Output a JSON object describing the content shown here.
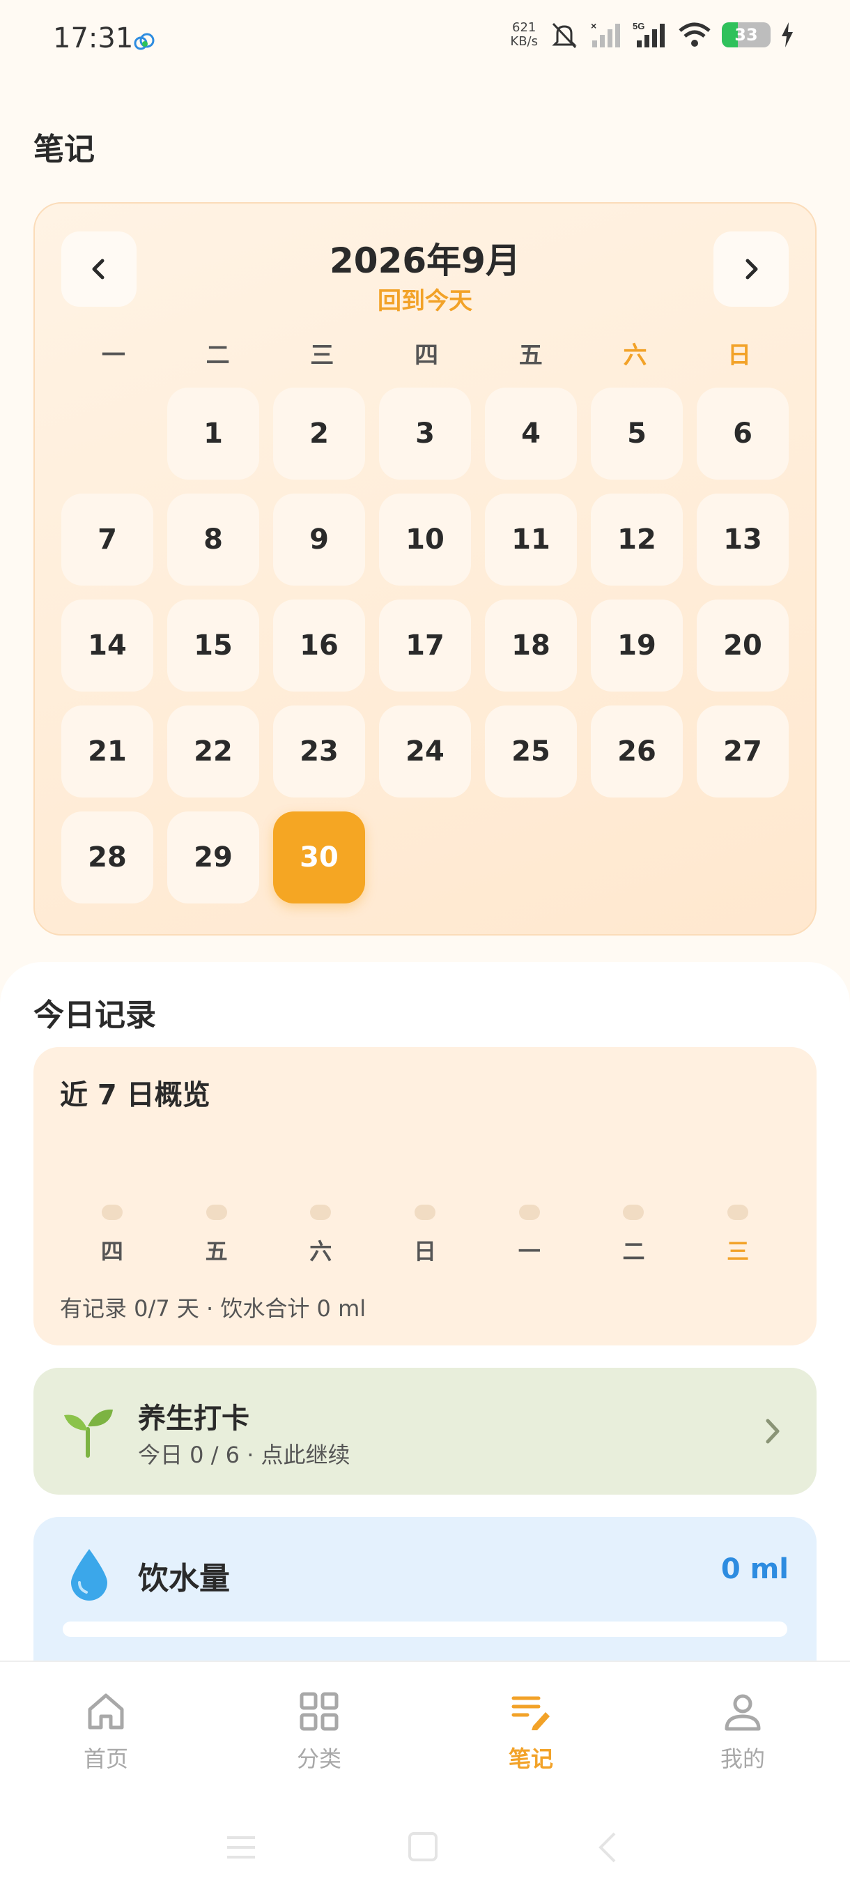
{
  "status_bar": {
    "time": "17:31",
    "net_speed_value": "621",
    "net_speed_unit": "KB/s",
    "network": "5G",
    "battery": "33",
    "battery_level": 0.33
  },
  "page": {
    "title": "笔记"
  },
  "calendar": {
    "month_title": "2026年9月",
    "today_link": "回到今天",
    "weekdays": [
      "一",
      "二",
      "三",
      "四",
      "五",
      "六",
      "日"
    ],
    "days": [
      "",
      "1",
      "2",
      "3",
      "4",
      "5",
      "6",
      "7",
      "8",
      "9",
      "10",
      "11",
      "12",
      "13",
      "14",
      "15",
      "16",
      "17",
      "18",
      "19",
      "20",
      "21",
      "22",
      "23",
      "24",
      "25",
      "26",
      "27",
      "28",
      "29",
      "30"
    ],
    "selected_day": "30",
    "accent_color": "#f5a623"
  },
  "records": {
    "section_title": "今日记录",
    "overview": {
      "title": "近 7 日概览",
      "days": [
        "四",
        "五",
        "六",
        "日",
        "一",
        "二",
        "三"
      ],
      "summary": "有记录 0/7 天 · 饮水合计 0 ml"
    },
    "checkin": {
      "title": "养生打卡",
      "subtitle": "今日 0 / 6 · 点此继续",
      "color": "#e8eedb"
    },
    "water": {
      "title": "饮水量",
      "value": "0 ml",
      "color": "#2d8ce0"
    }
  },
  "tab_bar": {
    "tabs": [
      {
        "label": "首页",
        "icon": "home-icon"
      },
      {
        "label": "分类",
        "icon": "grid-icon"
      },
      {
        "label": "笔记",
        "icon": "note-edit-icon"
      },
      {
        "label": "我的",
        "icon": "user-icon"
      }
    ],
    "active_index": 2
  }
}
